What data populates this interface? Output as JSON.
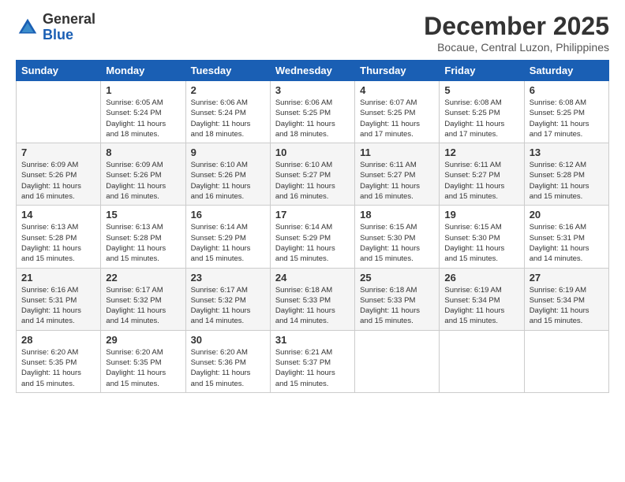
{
  "header": {
    "logo_line1": "General",
    "logo_line2": "Blue",
    "month_title": "December 2025",
    "location": "Bocaue, Central Luzon, Philippines"
  },
  "days_of_week": [
    "Sunday",
    "Monday",
    "Tuesday",
    "Wednesday",
    "Thursday",
    "Friday",
    "Saturday"
  ],
  "weeks": [
    [
      {
        "day": "",
        "sunrise": "",
        "sunset": "",
        "daylight": ""
      },
      {
        "day": "1",
        "sunrise": "Sunrise: 6:05 AM",
        "sunset": "Sunset: 5:24 PM",
        "daylight": "Daylight: 11 hours and 18 minutes."
      },
      {
        "day": "2",
        "sunrise": "Sunrise: 6:06 AM",
        "sunset": "Sunset: 5:24 PM",
        "daylight": "Daylight: 11 hours and 18 minutes."
      },
      {
        "day": "3",
        "sunrise": "Sunrise: 6:06 AM",
        "sunset": "Sunset: 5:25 PM",
        "daylight": "Daylight: 11 hours and 18 minutes."
      },
      {
        "day": "4",
        "sunrise": "Sunrise: 6:07 AM",
        "sunset": "Sunset: 5:25 PM",
        "daylight": "Daylight: 11 hours and 17 minutes."
      },
      {
        "day": "5",
        "sunrise": "Sunrise: 6:08 AM",
        "sunset": "Sunset: 5:25 PM",
        "daylight": "Daylight: 11 hours and 17 minutes."
      },
      {
        "day": "6",
        "sunrise": "Sunrise: 6:08 AM",
        "sunset": "Sunset: 5:25 PM",
        "daylight": "Daylight: 11 hours and 17 minutes."
      }
    ],
    [
      {
        "day": "7",
        "sunrise": "Sunrise: 6:09 AM",
        "sunset": "Sunset: 5:26 PM",
        "daylight": "Daylight: 11 hours and 16 minutes."
      },
      {
        "day": "8",
        "sunrise": "Sunrise: 6:09 AM",
        "sunset": "Sunset: 5:26 PM",
        "daylight": "Daylight: 11 hours and 16 minutes."
      },
      {
        "day": "9",
        "sunrise": "Sunrise: 6:10 AM",
        "sunset": "Sunset: 5:26 PM",
        "daylight": "Daylight: 11 hours and 16 minutes."
      },
      {
        "day": "10",
        "sunrise": "Sunrise: 6:10 AM",
        "sunset": "Sunset: 5:27 PM",
        "daylight": "Daylight: 11 hours and 16 minutes."
      },
      {
        "day": "11",
        "sunrise": "Sunrise: 6:11 AM",
        "sunset": "Sunset: 5:27 PM",
        "daylight": "Daylight: 11 hours and 16 minutes."
      },
      {
        "day": "12",
        "sunrise": "Sunrise: 6:11 AM",
        "sunset": "Sunset: 5:27 PM",
        "daylight": "Daylight: 11 hours and 15 minutes."
      },
      {
        "day": "13",
        "sunrise": "Sunrise: 6:12 AM",
        "sunset": "Sunset: 5:28 PM",
        "daylight": "Daylight: 11 hours and 15 minutes."
      }
    ],
    [
      {
        "day": "14",
        "sunrise": "Sunrise: 6:13 AM",
        "sunset": "Sunset: 5:28 PM",
        "daylight": "Daylight: 11 hours and 15 minutes."
      },
      {
        "day": "15",
        "sunrise": "Sunrise: 6:13 AM",
        "sunset": "Sunset: 5:28 PM",
        "daylight": "Daylight: 11 hours and 15 minutes."
      },
      {
        "day": "16",
        "sunrise": "Sunrise: 6:14 AM",
        "sunset": "Sunset: 5:29 PM",
        "daylight": "Daylight: 11 hours and 15 minutes."
      },
      {
        "day": "17",
        "sunrise": "Sunrise: 6:14 AM",
        "sunset": "Sunset: 5:29 PM",
        "daylight": "Daylight: 11 hours and 15 minutes."
      },
      {
        "day": "18",
        "sunrise": "Sunrise: 6:15 AM",
        "sunset": "Sunset: 5:30 PM",
        "daylight": "Daylight: 11 hours and 15 minutes."
      },
      {
        "day": "19",
        "sunrise": "Sunrise: 6:15 AM",
        "sunset": "Sunset: 5:30 PM",
        "daylight": "Daylight: 11 hours and 15 minutes."
      },
      {
        "day": "20",
        "sunrise": "Sunrise: 6:16 AM",
        "sunset": "Sunset: 5:31 PM",
        "daylight": "Daylight: 11 hours and 14 minutes."
      }
    ],
    [
      {
        "day": "21",
        "sunrise": "Sunrise: 6:16 AM",
        "sunset": "Sunset: 5:31 PM",
        "daylight": "Daylight: 11 hours and 14 minutes."
      },
      {
        "day": "22",
        "sunrise": "Sunrise: 6:17 AM",
        "sunset": "Sunset: 5:32 PM",
        "daylight": "Daylight: 11 hours and 14 minutes."
      },
      {
        "day": "23",
        "sunrise": "Sunrise: 6:17 AM",
        "sunset": "Sunset: 5:32 PM",
        "daylight": "Daylight: 11 hours and 14 minutes."
      },
      {
        "day": "24",
        "sunrise": "Sunrise: 6:18 AM",
        "sunset": "Sunset: 5:33 PM",
        "daylight": "Daylight: 11 hours and 14 minutes."
      },
      {
        "day": "25",
        "sunrise": "Sunrise: 6:18 AM",
        "sunset": "Sunset: 5:33 PM",
        "daylight": "Daylight: 11 hours and 15 minutes."
      },
      {
        "day": "26",
        "sunrise": "Sunrise: 6:19 AM",
        "sunset": "Sunset: 5:34 PM",
        "daylight": "Daylight: 11 hours and 15 minutes."
      },
      {
        "day": "27",
        "sunrise": "Sunrise: 6:19 AM",
        "sunset": "Sunset: 5:34 PM",
        "daylight": "Daylight: 11 hours and 15 minutes."
      }
    ],
    [
      {
        "day": "28",
        "sunrise": "Sunrise: 6:20 AM",
        "sunset": "Sunset: 5:35 PM",
        "daylight": "Daylight: 11 hours and 15 minutes."
      },
      {
        "day": "29",
        "sunrise": "Sunrise: 6:20 AM",
        "sunset": "Sunset: 5:35 PM",
        "daylight": "Daylight: 11 hours and 15 minutes."
      },
      {
        "day": "30",
        "sunrise": "Sunrise: 6:20 AM",
        "sunset": "Sunset: 5:36 PM",
        "daylight": "Daylight: 11 hours and 15 minutes."
      },
      {
        "day": "31",
        "sunrise": "Sunrise: 6:21 AM",
        "sunset": "Sunset: 5:37 PM",
        "daylight": "Daylight: 11 hours and 15 minutes."
      },
      {
        "day": "",
        "sunrise": "",
        "sunset": "",
        "daylight": ""
      },
      {
        "day": "",
        "sunrise": "",
        "sunset": "",
        "daylight": ""
      },
      {
        "day": "",
        "sunrise": "",
        "sunset": "",
        "daylight": ""
      }
    ]
  ]
}
